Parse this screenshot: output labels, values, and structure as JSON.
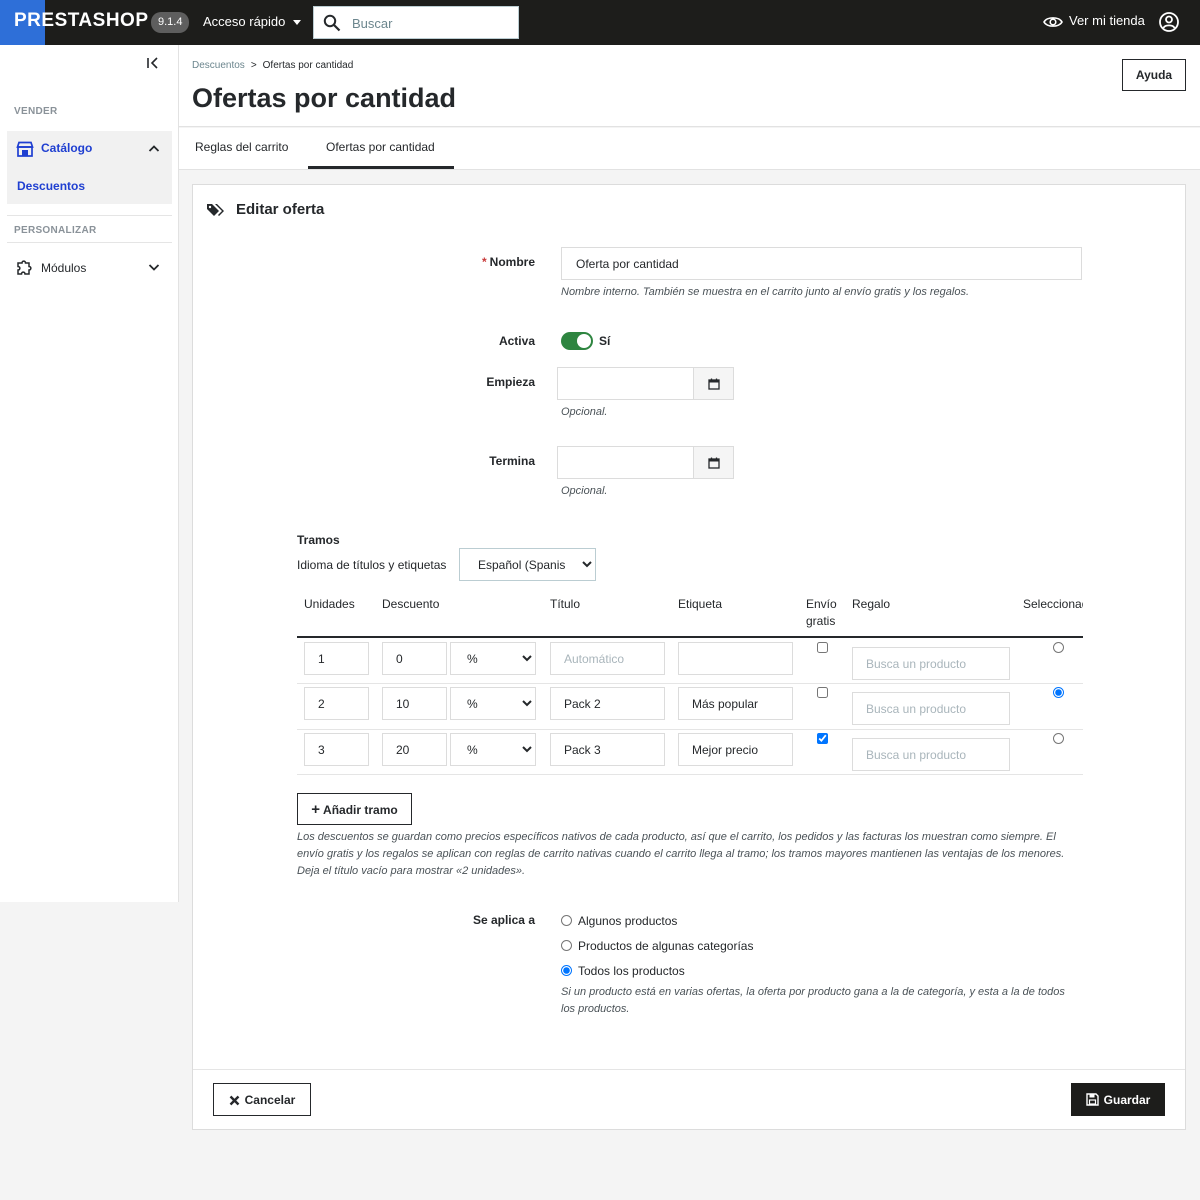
{
  "topbar": {
    "logo_text": "PRESTASHOP",
    "version": "9.1.4",
    "quick_access": "Acceso rápido",
    "search_placeholder": "Buscar",
    "view_shop": "Ver mi tienda"
  },
  "sidebar": {
    "section_sell": "VENDER",
    "catalog": "Catálogo",
    "discounts": "Descuentos",
    "section_customize": "PERSONALIZAR",
    "modules": "Módulos"
  },
  "header": {
    "breadcrumb_parent": "Descuentos",
    "breadcrumb_sep": ">",
    "breadcrumb_current": "Ofertas por cantidad",
    "title": "Ofertas por cantidad",
    "help": "Ayuda"
  },
  "tabs": [
    {
      "label": "Reglas del carrito"
    },
    {
      "label": "Ofertas por cantidad",
      "active": true
    }
  ],
  "form": {
    "heading": "Editar oferta",
    "name_required": "*",
    "name_label": "Nombre",
    "name_value": "Oferta por cantidad",
    "name_hint": "Nombre interno. También se muestra en el carrito junto al envío gratis y los regalos.",
    "active_label": "Activa",
    "active_value": "Sí",
    "start_label": "Empieza",
    "start_hint": "Opcional.",
    "end_label": "Termina",
    "end_hint": "Opcional.",
    "tiers_label": "Tramos",
    "lang_label": "Idioma de títulos y etiquetas",
    "lang_value": "Español (Spanish)",
    "columns": {
      "units": "Unidades",
      "discount": "Descuento",
      "title": "Título",
      "tag": "Etiqueta",
      "free_ship_1": "Envío",
      "free_ship_2": "gratis",
      "gift": "Regalo",
      "select": "Seleccionada"
    },
    "title_placeholder": "Automático",
    "gift_placeholder": "Busca un producto",
    "rows": [
      {
        "units": "1",
        "discount": "0",
        "type": "%",
        "title": "",
        "tag": "",
        "free_shipping": false,
        "selected": false
      },
      {
        "units": "2",
        "discount": "10",
        "type": "%",
        "title": "Pack 2",
        "tag": "Más popular",
        "free_shipping": false,
        "selected": true
      },
      {
        "units": "3",
        "discount": "20",
        "type": "%",
        "title": "Pack 3",
        "tag": "Mejor precio",
        "free_shipping": true,
        "selected": false
      }
    ],
    "add_tier": "Añadir tramo",
    "tiers_note": "Los descuentos se guardan como precios específicos nativos de cada producto, así que el carrito, los pedidos y las facturas los muestran como siempre. El envío gratis y los regalos se aplican con reglas de carrito nativas cuando el carrito llega al tramo; los tramos mayores mantienen las ventajas de los menores. Deja el título vacío para mostrar «2 unidades».",
    "applies_label": "Se aplica a",
    "applies_options": [
      "Algunos productos",
      "Productos de algunas categorías",
      "Todos los productos"
    ],
    "applies_selected": "Todos los productos",
    "applies_hint": "Si un producto está en varias ofertas, la oferta por producto gana a la de categoría, y esta a la de todos los productos.",
    "cancel": "Cancelar",
    "save": "Guardar"
  },
  "colors": {
    "topbar": "#1d1d1b",
    "brand_blue": "#2e6fd8",
    "active_link": "#1f3fd1",
    "toggle_on": "#2e8540"
  }
}
